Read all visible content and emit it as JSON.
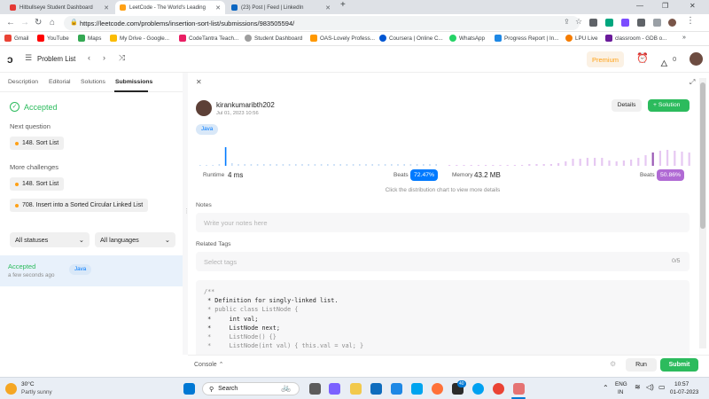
{
  "browser": {
    "tabs": [
      {
        "title": "Hitbullseye Student Dashboard",
        "active": false
      },
      {
        "title": "LeetCode - The World's Leading",
        "active": true
      },
      {
        "title": "(23) Post | Feed | LinkedIn",
        "active": false
      }
    ],
    "new_tab": "+",
    "url": "https://leetcode.com/problems/insertion-sort-list/submissions/983505594/",
    "bookmarks": [
      "Gmail",
      "YouTube",
      "Maps",
      "My Drive - Google...",
      "CodeTantra Teach...",
      "Student Dashboard",
      "OAS-Lovely Profess...",
      "Coursera | Online C...",
      "WhatsApp",
      "Progress Report | In...",
      "LPU Live",
      "classroom - GDB o..."
    ],
    "colors": {
      "accent": "#1a73e8"
    }
  },
  "header": {
    "problem_list": "Problem List",
    "premium": "Premium",
    "streak": "0"
  },
  "left": {
    "tabs": [
      "Description",
      "Editorial",
      "Solutions",
      "Submissions"
    ],
    "accepted": "Accepted",
    "next_question_label": "Next question",
    "next_question": "148. Sort List",
    "more_challenges_label": "More challenges",
    "challenges": [
      "148. Sort List",
      "708. Insert into a Sorted Circular Linked List"
    ],
    "filter_status": "All statuses",
    "filter_lang": "All languages",
    "submission": {
      "status": "Accepted",
      "time": "a few seconds ago",
      "lang": "Java"
    }
  },
  "right": {
    "username": "kirankumaribth202",
    "date": "Jul 01, 2023 10:56",
    "details_btn": "Details",
    "solution_btn": "Solution",
    "lang_tag": "Java",
    "runtime_label": "Runtime",
    "runtime": "4 ms",
    "runtime_beats_label": "Beats",
    "runtime_beats": "72.47%",
    "memory_label": "Memory",
    "memory": "43.2 MB",
    "memory_beats_label": "Beats",
    "memory_beats": "50.86%",
    "distribution_hint": "Click the distribution chart to view more details",
    "notes_label": "Notes",
    "notes_placeholder": "Write your notes here",
    "tags_label": "Related Tags",
    "tags_placeholder": "Select tags",
    "tags_count": "0/5",
    "code_lines": [
      "/**",
      " * Definition for singly-linked list.",
      " * public class ListNode {",
      " *     int val;",
      " *     ListNode next;",
      " *     ListNode() {}",
      " *     ListNode(int val) { this.val = val; }"
    ]
  },
  "bottom": {
    "console": "Console",
    "run": "Run",
    "submit": "Submit"
  },
  "taskbar": {
    "weather_temp": "30°C",
    "weather_desc": "Partly sunny",
    "search": "Search",
    "lang1": "ENG",
    "lang2": "IN",
    "time": "10:57",
    "date": "01-07-2023",
    "badge": "40"
  },
  "colors": {
    "green": "#2cbb5d",
    "blue": "#007aff",
    "purple": "#9b59b6",
    "orange": "#ffa116"
  }
}
